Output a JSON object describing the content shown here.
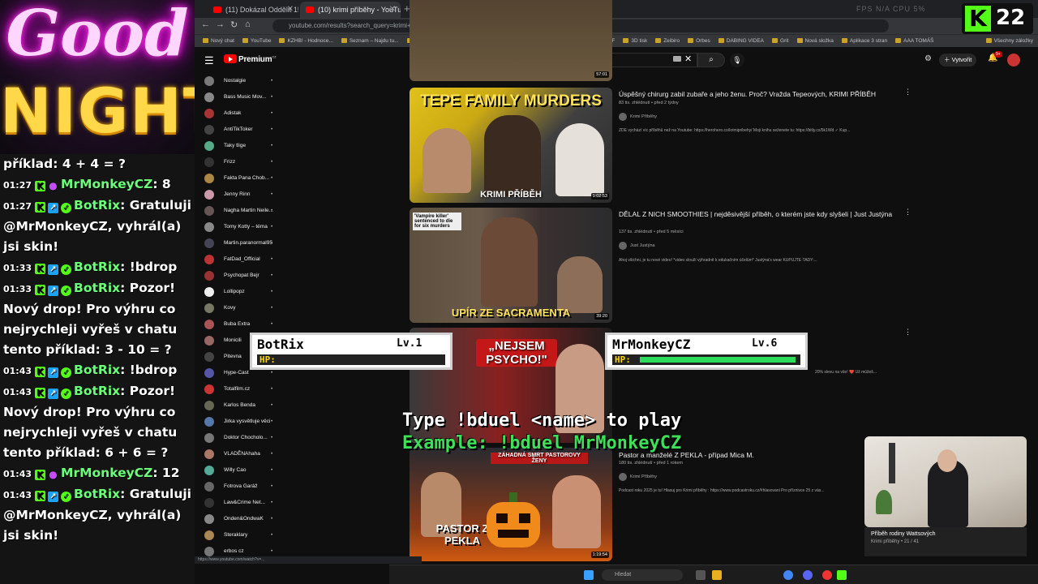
{
  "overlay": {
    "good": "Good",
    "night": "NIGHT",
    "chat": [
      {
        "ts": "",
        "user": "",
        "text": "příklad: 4 + 4 = ?",
        "badges": []
      },
      {
        "ts": "01:27",
        "user": "MrMonkeyCZ",
        "text": ": 8",
        "badges": [
          "kick",
          "mic"
        ]
      },
      {
        "ts": "01:27",
        "user": "BotRix",
        "text": ": Gratuluji",
        "badges": [
          "kick",
          "bot",
          "verified"
        ]
      },
      {
        "ts": "",
        "user": "",
        "text": "@MrMonkeyCZ, vyhrál(a) jsi skin!",
        "badges": []
      },
      {
        "ts": "01:33",
        "user": "BotRix",
        "text": ": !bdrop",
        "badges": [
          "kick",
          "bot",
          "verified"
        ]
      },
      {
        "ts": "01:33",
        "user": "BotRix",
        "text": ": Pozor! Nový drop! Pro výhru co nejrychleji vyřeš v chatu tento příklad: 3 - 10 = ?",
        "badges": [
          "kick",
          "bot",
          "verified"
        ]
      },
      {
        "ts": "01:43",
        "user": "BotRix",
        "text": ": !bdrop",
        "badges": [
          "kick",
          "bot",
          "verified"
        ]
      },
      {
        "ts": "01:43",
        "user": "BotRix",
        "text": ": Pozor! Nový drop! Pro výhru co nejrychleji vyřeš v chatu tento příklad: 6 + 6 = ?",
        "badges": [
          "kick",
          "bot",
          "verified"
        ]
      },
      {
        "ts": "01:43",
        "user": "MrMonkeyCZ",
        "text": ": 12",
        "badges": [
          "kick",
          "mic"
        ]
      },
      {
        "ts": "01:43",
        "user": "BotRix",
        "text": ": Gratuluji @MrMonkeyCZ, vyhrál(a) jsi skin!",
        "badges": [
          "kick",
          "bot",
          "verified"
        ]
      }
    ]
  },
  "kick": {
    "count": "22",
    "logo": "K"
  },
  "browser": {
    "tabs": [
      {
        "title": "(11) Dokázal Oddělit 15-leté..."
      },
      {
        "title": "(10) krimi příběhy - YouTube"
      }
    ],
    "new_tab": "+",
    "right_text": "FPS N/A  CPU 5%",
    "url": "youtube.com/results?search_query=krimi+pribehy",
    "bookmarks": [
      "Nový chat",
      "YouTube",
      "KZHB! - Hodnoce...",
      "Seznam – Najdu tu...",
      "Recordings - Stream...",
      "Gemini",
      "Create Better Video...",
      "AI",
      "DTF",
      "3D tisk",
      "Zeibiro",
      "Orbes",
      "DABING VIDEA",
      "Grit",
      "Nová složka",
      "Aplikace 3 stran",
      "AAA TOMÁŠ"
    ],
    "bookmarks_other": "Všechny záložky",
    "status_url": "https://www.youtube.com/watch?v=...",
    "nav": {
      "back": "←",
      "forward": "→",
      "reload": "↻",
      "home": "⌂"
    }
  },
  "youtube": {
    "logo": "Premium",
    "logo_sup": "CZ",
    "search_value": "krimi příběhy",
    "create_label": "Vytvořit",
    "bell_badge": "9+",
    "icons": {
      "hamburger": "☰",
      "search": "⌕",
      "mic": "🎙",
      "clear": "✕",
      "bell": "🔔",
      "menu": "⋮",
      "cast": "⚙"
    },
    "sidebar": [
      {
        "label": "Nostalgie",
        "color": "#7a7a7a"
      },
      {
        "label": "Bass Music Mov...",
        "color": "#888"
      },
      {
        "label": "Adistak",
        "color": "#a33"
      },
      {
        "label": "AntiTikToker",
        "color": "#444"
      },
      {
        "label": "Taky tlige",
        "color": "#5a8"
      },
      {
        "label": "Frizz",
        "color": "#333"
      },
      {
        "label": "Fakta Pana Chob...",
        "color": "#a84"
      },
      {
        "label": "Jenny Rinn",
        "color": "#c9a"
      },
      {
        "label": "Nagha Martin Neile...",
        "color": "#655"
      },
      {
        "label": "Tomy Kotty – téma",
        "color": "#888"
      },
      {
        "label": "Martin.paranormal95",
        "color": "#445"
      },
      {
        "label": "FatDad_Official",
        "color": "#b33"
      },
      {
        "label": "Psychopat Bejr",
        "color": "#933"
      },
      {
        "label": "Lollipopz",
        "color": "#eee"
      },
      {
        "label": "Kovy",
        "color": "#776"
      },
      {
        "label": "Buba Extra",
        "color": "#a55"
      },
      {
        "label": "Monicili",
        "color": "#966"
      },
      {
        "label": "Pitevna",
        "color": "#444"
      },
      {
        "label": "Hype-Cast",
        "color": "#55a"
      },
      {
        "label": "Totalfilm.cz",
        "color": "#c33"
      },
      {
        "label": "Karlos Benda",
        "color": "#665"
      },
      {
        "label": "Jirka vysvětluje věci",
        "color": "#57a"
      },
      {
        "label": "Doktor Chocholo...",
        "color": "#777"
      },
      {
        "label": "VLADĚNAhaha",
        "color": "#a76"
      },
      {
        "label": "Willy Cao",
        "color": "#5a9"
      },
      {
        "label": "Fotrova Garáž",
        "color": "#666"
      },
      {
        "label": "Law&Crime Net...",
        "color": "#333"
      },
      {
        "label": "Onden&OndwaK",
        "color": "#888"
      },
      {
        "label": "Steraklary",
        "color": "#a85"
      },
      {
        "label": "erbos cz",
        "color": "#777"
      }
    ],
    "results": [
      {
        "duration": "57:01",
        "title": "",
        "caption": ""
      },
      {
        "duration": "1:02:53",
        "title": "Úspěšný chirurg zabil zubaře a jeho ženu. Proč? Vražda Tepeových, KRIMI PŘÍBĚH",
        "meta": "83 tis. zhlédnutí • před 2 týdny",
        "channel": "Krimi Příběhy",
        "desc": "ZDE vychází víc příběhů než na Youtube: https://herohero.co/krimipribehy/ Moji knihu seženete tu: https://bitly.cx/5k1Wd ✓ Kup...",
        "caption_top": "TEPE FAMILY MURDERS",
        "caption_bottom": "KRIMI PŘÍBĚH"
      },
      {
        "duration": "39:20",
        "title": "DĚLAL Z NICH SMOOTHIES | nejděsivější příběh, o kterém jste kdy slyšeli | Just Justýna",
        "meta": "137 tis. zhlédnutí • před 5 měsíci",
        "channel": "Just Justýna",
        "desc": "Ahoj všichni, je tu nové video! *video slouží výhradně k edukačním účelům* Justýna's wear KUPUJTE TADY:...",
        "caption_top": "'Vampire killer' sentenced to die for six murders",
        "caption_bottom": "UPÍR ZE SACRAMENTA"
      },
      {
        "duration": "",
        "title": "",
        "meta": "",
        "channel": "",
        "desc": "20% slevu na vše! ❤️ Už můžeš...",
        "caption_top": "„NEJSEM PSYCHO!\""
      },
      {
        "duration": "1:19:54",
        "title": "Pastor a manželé Z PEKLA - případ Mica M.",
        "meta": "180 tis. zhlédnutí • před 1 rokem",
        "channel": "Krimi Příběhy",
        "desc": "Podcast roku 2025 je tu! Hlasuj pro Krimi příběhy : https://www.podcastroku.cz/#hlasovani Pro příznivce 25 z vás...",
        "caption_top": "ZÁHADNÁ SMRT PASTOROVY ŽENY",
        "caption_bottom": "PASTOR Z PEKLA"
      }
    ],
    "miniplayer": {
      "title": "Příběh rodiny Wattsových",
      "sub": "Krimi příběhy • 21 / 41"
    }
  },
  "game": {
    "p1": {
      "name": "BotRix",
      "level": "Lv.1",
      "hp_label": "HP:",
      "hp": 0
    },
    "p2": {
      "name": "MrMonkeyCZ",
      "level": "Lv.6",
      "hp_label": "HP:",
      "hp": 1.0
    },
    "cmd_line1": "Type !bduel <name> to play",
    "cmd_line2": "Example: !bduel MrMonkeyCZ"
  },
  "taskbar": {
    "search": "Hledat",
    "tray": "^  ☁  🔊  ⌁"
  }
}
